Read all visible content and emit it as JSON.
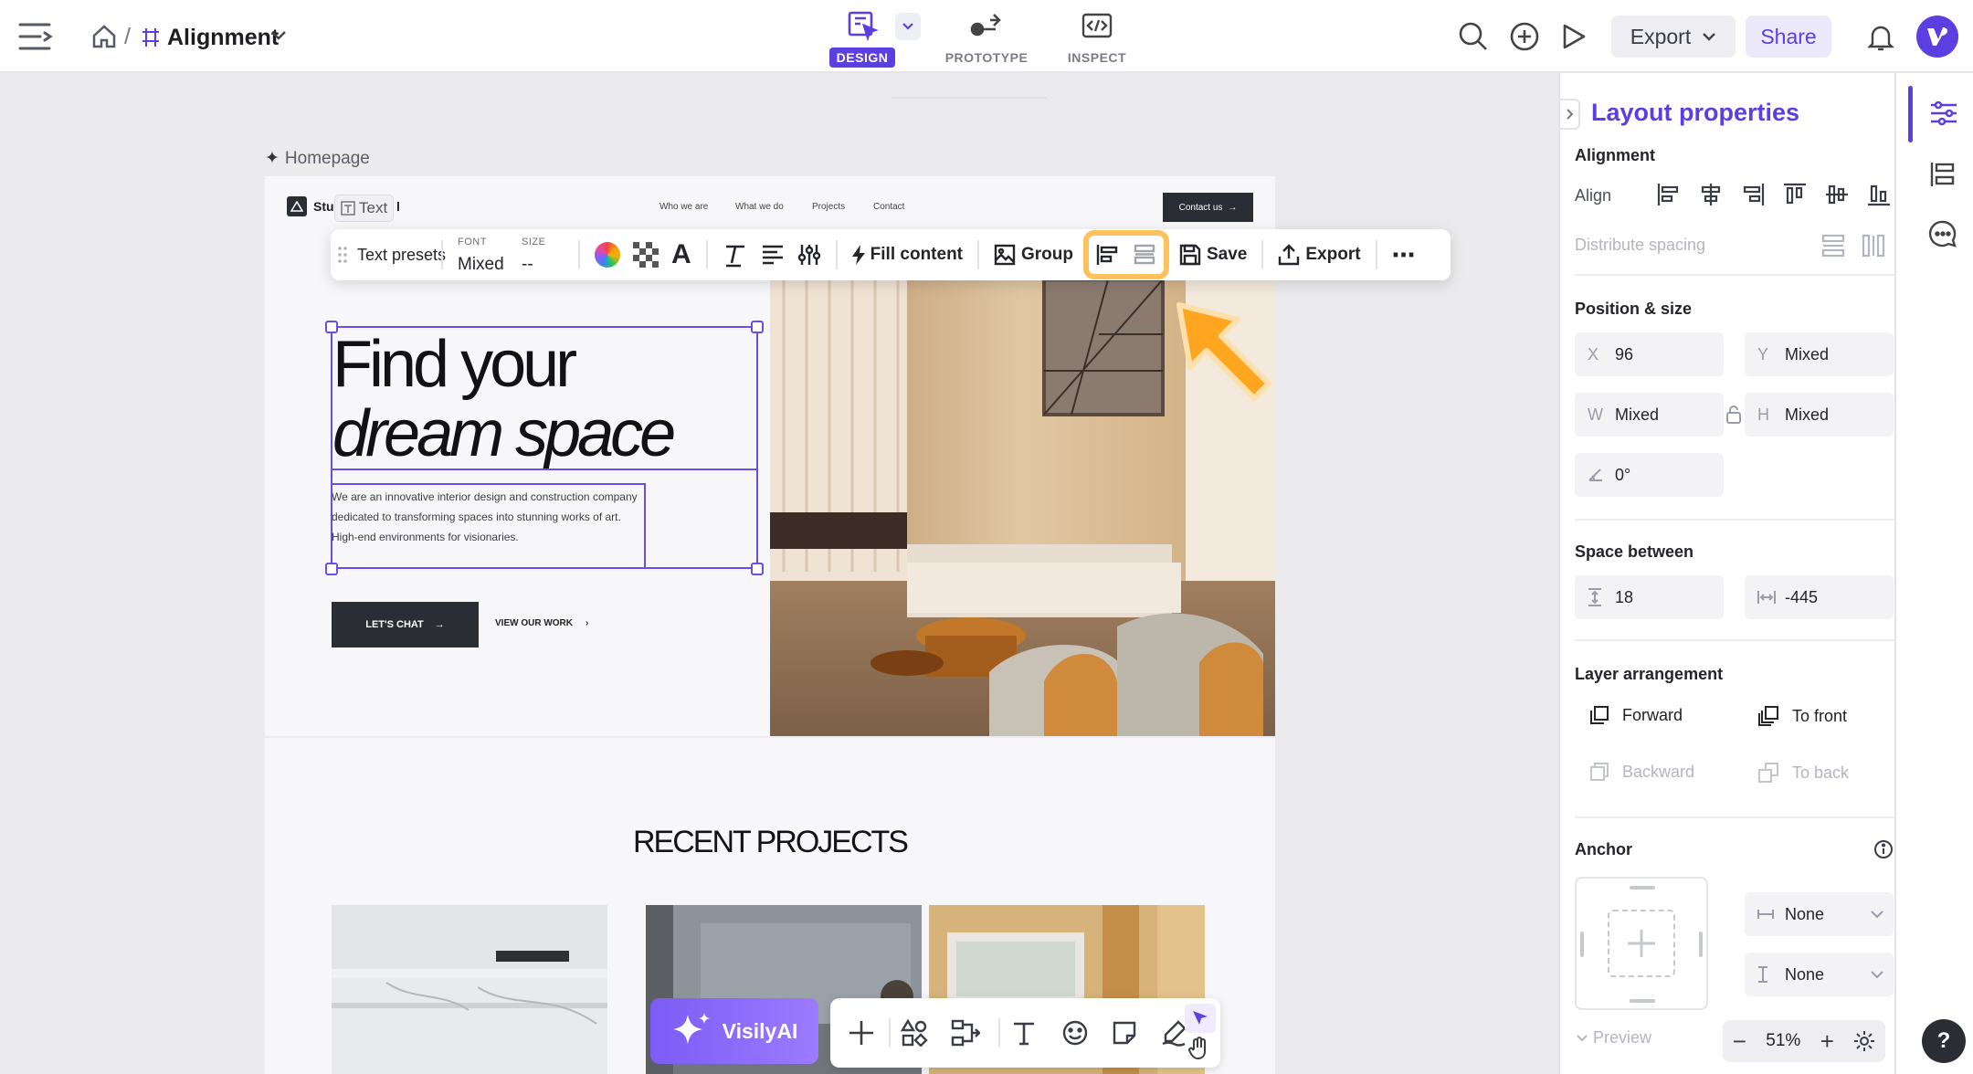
{
  "topbar": {
    "breadcrumb_sep": "/",
    "file_name": "Alignment",
    "modes": [
      {
        "label": "DESIGN",
        "active": true
      },
      {
        "label": "PROTOTYPE",
        "active": false
      },
      {
        "label": "INSPECT",
        "active": false
      }
    ],
    "export_label": "Export",
    "share_label": "Share",
    "accent": "#5b3fe0"
  },
  "canvas": {
    "frame_label": "Homepage",
    "site": {
      "logo_text": "Stu",
      "logo_text_end": "l",
      "text_badge": "Text",
      "nav": [
        "Who we are",
        "What we do",
        "Projects",
        "Contact"
      ],
      "contact_btn": "Contact us",
      "hero_line1": "Find your",
      "hero_line2": "dream space",
      "hero_body": "We are an innovative interior design and construction company dedicated to transforming spaces into stunning works of art. High-end environments for visionaries.",
      "cta_primary": "LET'S CHAT",
      "cta_secondary": "VIEW OUR WORK",
      "recent_title": "RECENT PROJECTS"
    }
  },
  "toolbar": {
    "text_presets": "Text presets",
    "font_label": "FONT",
    "font_value": "Mixed",
    "size_label": "SIZE",
    "size_value": "--",
    "fill_content": "Fill content",
    "group": "Group",
    "save": "Save",
    "export": "Export",
    "more": "⋯"
  },
  "panel": {
    "title": "Layout properties",
    "alignment": {
      "heading": "Alignment",
      "align_label": "Align",
      "distribute_label": "Distribute spacing"
    },
    "position": {
      "heading": "Position & size",
      "x_key": "X",
      "x": "96",
      "y_key": "Y",
      "y": "Mixed",
      "w_key": "W",
      "w": "Mixed",
      "h_key": "H",
      "h": "Mixed",
      "rotation": "0°"
    },
    "space_between": {
      "heading": "Space between",
      "vertical": "18",
      "horizontal": "-445"
    },
    "layer": {
      "heading": "Layer arrangement",
      "forward": "Forward",
      "to_front": "To front",
      "backward": "Backward",
      "to_back": "To back"
    },
    "anchor": {
      "heading": "Anchor",
      "horizontal": "None",
      "vertical": "None"
    },
    "preview": "Preview"
  },
  "bottom": {
    "ai_label": "VisilyAI",
    "zoom": "51%",
    "help": "?"
  }
}
